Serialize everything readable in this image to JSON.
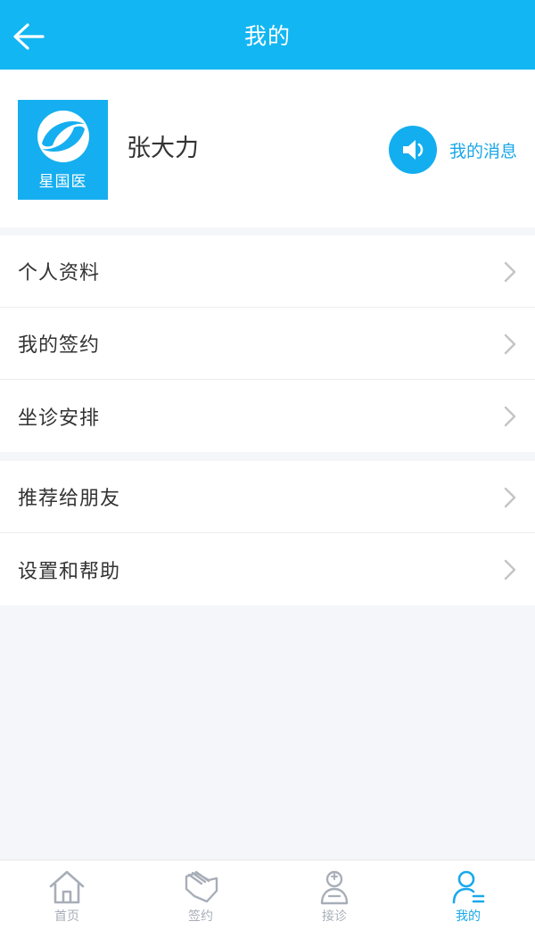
{
  "header": {
    "title": "我的",
    "back_icon": "arrow-left-icon",
    "background": "#12b6f3"
  },
  "profile": {
    "logo_text": "星国医",
    "logo_icon": "leaf-logo-icon",
    "name": "张大力",
    "messages_label": "我的消息",
    "messages_icon": "speaker-icon"
  },
  "menu": {
    "group1": [
      {
        "label": "个人资料"
      },
      {
        "label": "我的签约"
      },
      {
        "label": "坐诊安排"
      }
    ],
    "group2": [
      {
        "label": "推荐给朋友"
      },
      {
        "label": "设置和帮助"
      }
    ]
  },
  "tabbar": {
    "items": [
      {
        "label": "首页",
        "icon": "home-icon",
        "active": false
      },
      {
        "label": "签约",
        "icon": "handshake-icon",
        "active": false
      },
      {
        "label": "接诊",
        "icon": "doctor-icon",
        "active": false
      },
      {
        "label": "我的",
        "icon": "user-icon",
        "active": true
      }
    ],
    "active_color": "#18a9ec",
    "inactive_color": "#a8aeb8"
  }
}
